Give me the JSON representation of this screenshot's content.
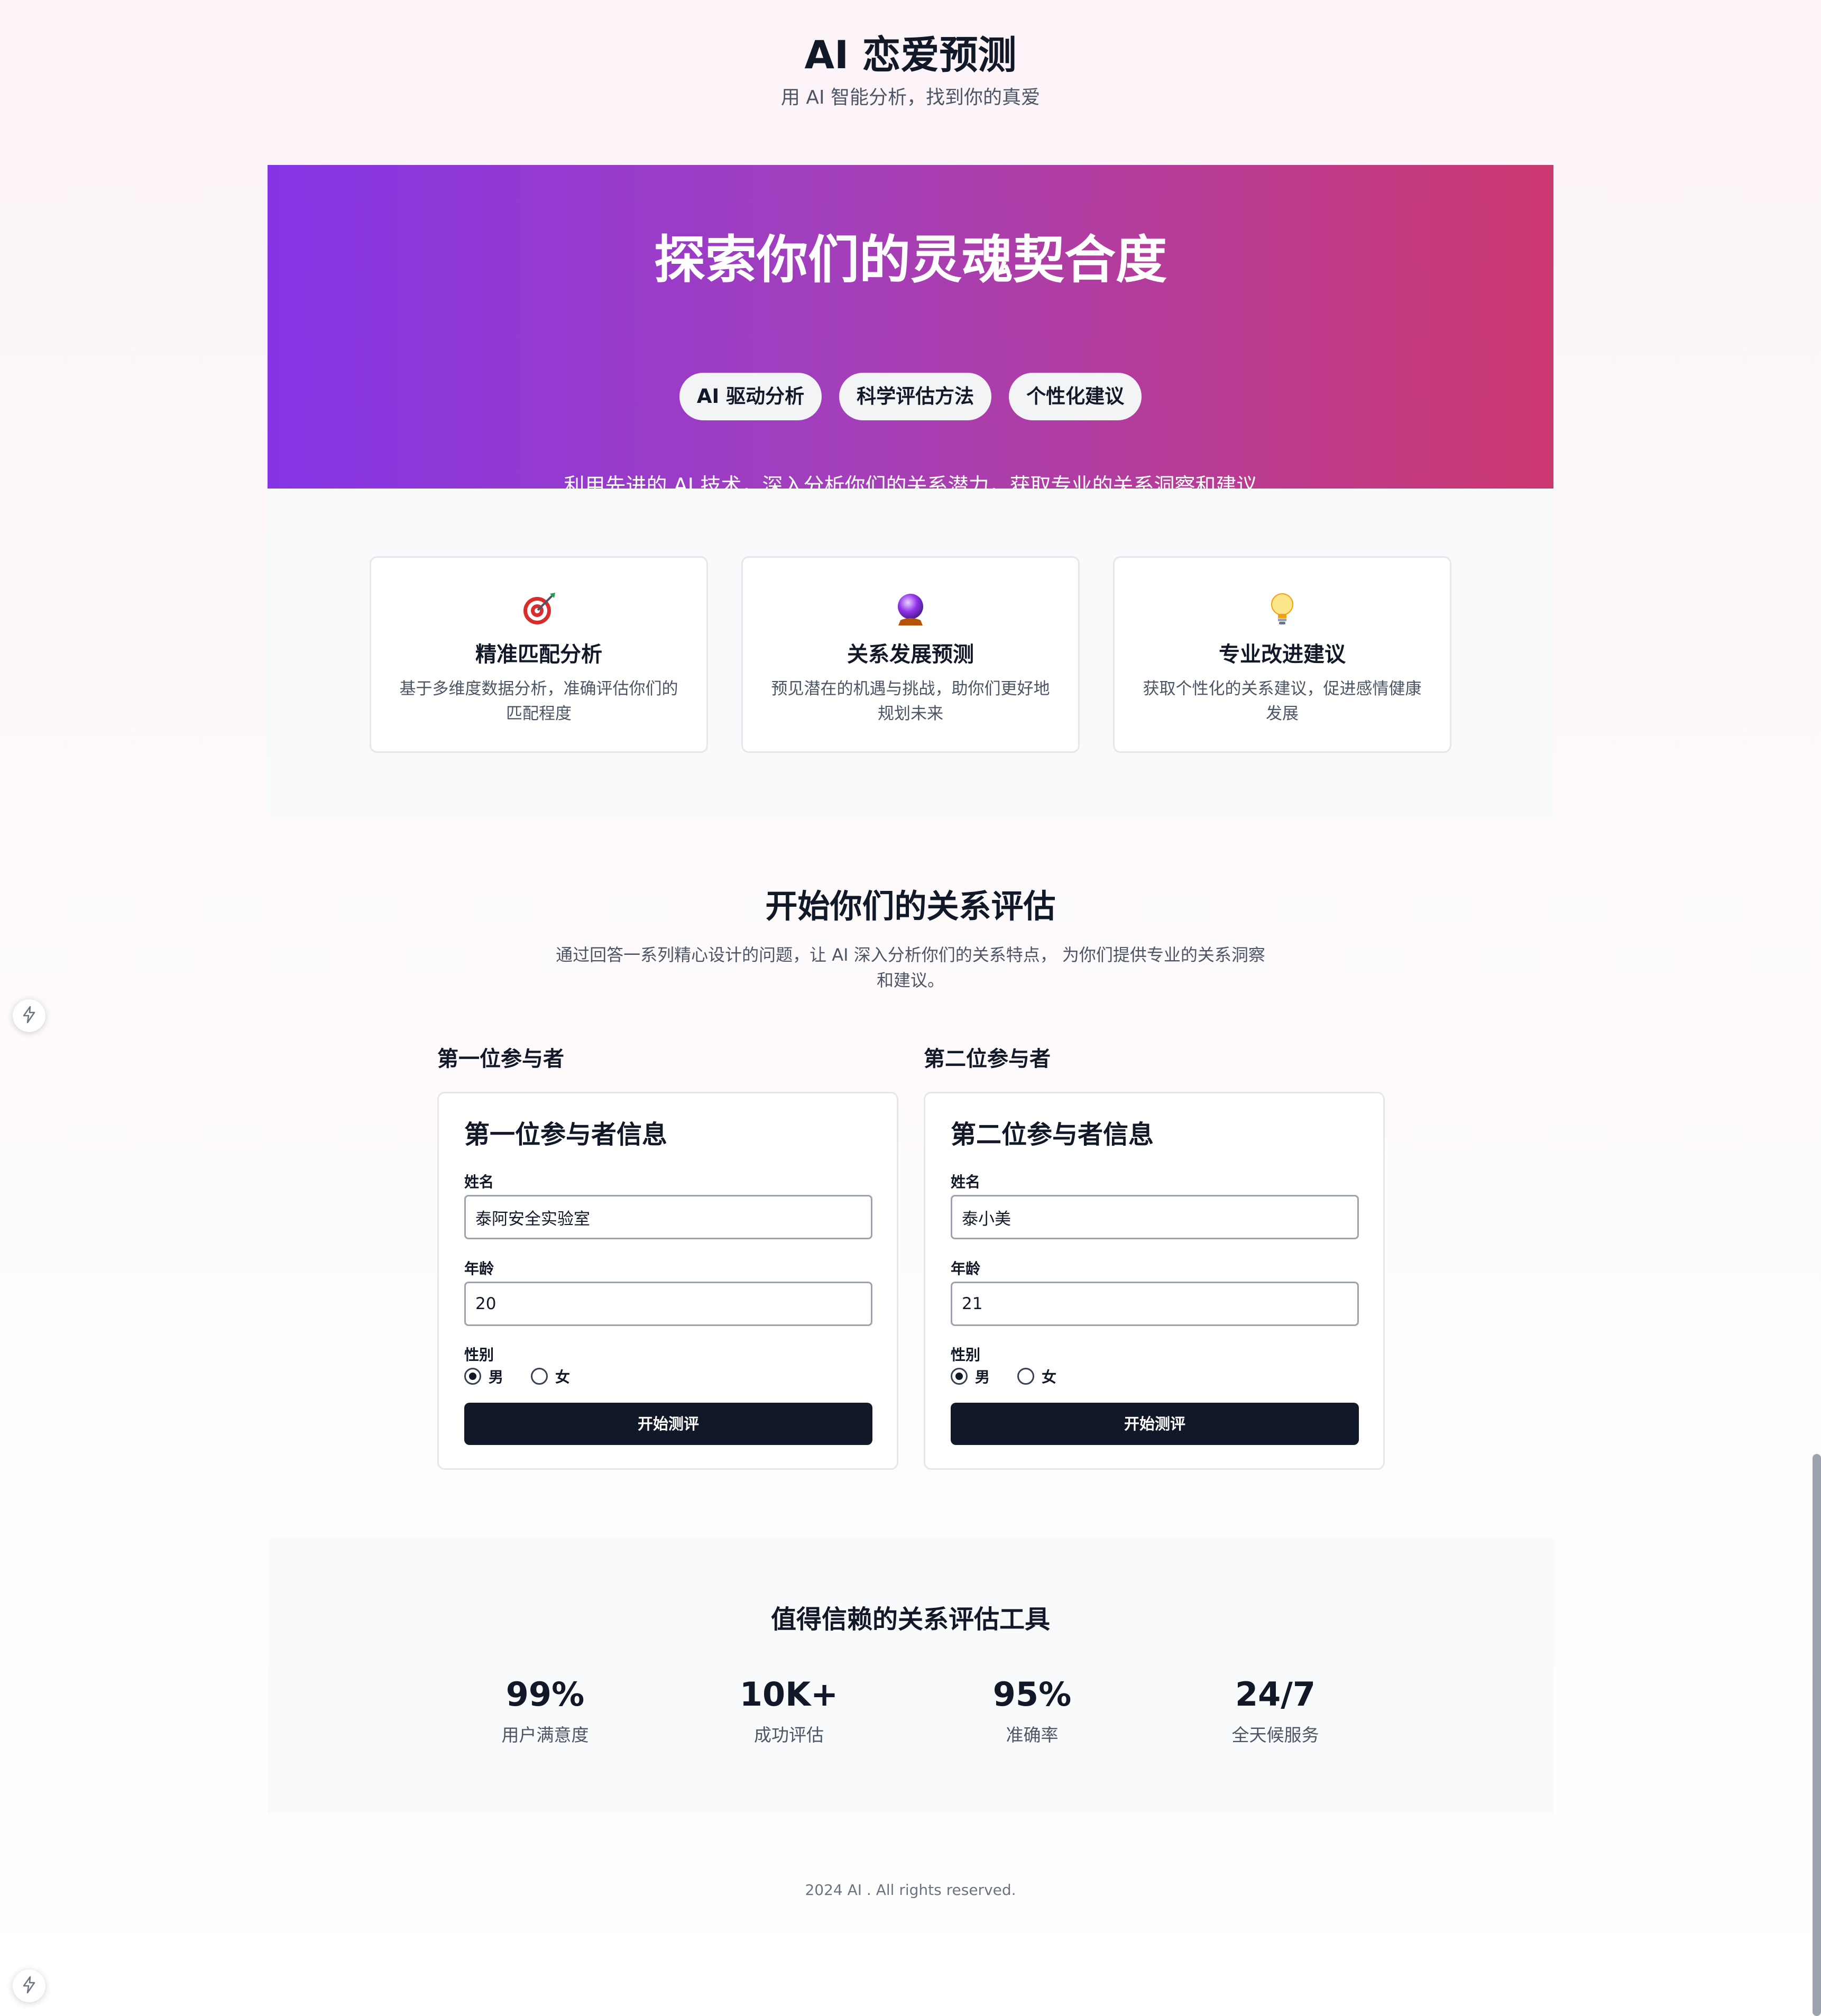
{
  "header": {
    "title": "AI 恋爱预测",
    "subtitle": "用 AI 智能分析，找到你的真爱"
  },
  "hero": {
    "title": "探索你们的灵魂契合度",
    "description": "利用先进的 AI 技术，深入分析你们的关系潜力，获取专业的关系洞察和建议",
    "tags": [
      "AI 驱动分析",
      "科学评估方法",
      "个性化建议"
    ],
    "gradient": [
      "#8635e6",
      "#cc3870"
    ]
  },
  "features": [
    {
      "icon": "target-icon",
      "title": "精准匹配分析",
      "desc": "基于多维度数据分析，准确评估你们的匹配程度"
    },
    {
      "icon": "crystal-ball-icon",
      "title": "关系发展预测",
      "desc": "预见潜在的机遇与挑战，助你们更好地规划未来"
    },
    {
      "icon": "lightbulb-icon",
      "title": "专业改进建议",
      "desc": "获取个性化的关系建议，促进感情健康发展"
    }
  ],
  "evaluation": {
    "title": "开始你们的关系评估",
    "description": "通过回答一系列精心设计的问题，让 AI 深入分析你们的关系特点， 为你们提供专业的关系洞察和建议。"
  },
  "participants": [
    {
      "section_label": "第一位参与者",
      "form_title": "第一位参与者信息",
      "name_label": "姓名",
      "name_value": "泰阿安全实验室",
      "age_label": "年龄",
      "age_value": "20",
      "gender_label": "性别",
      "gender_options": [
        "男",
        "女"
      ],
      "gender_selected": "男",
      "submit_label": "开始测评"
    },
    {
      "section_label": "第二位参与者",
      "form_title": "第二位参与者信息",
      "name_label": "姓名",
      "name_value": "泰小美",
      "age_label": "年龄",
      "age_value": "21",
      "gender_label": "性别",
      "gender_options": [
        "男",
        "女"
      ],
      "gender_selected": "男",
      "submit_label": "开始测评"
    }
  ],
  "stats": {
    "title": "值得信赖的关系评估工具",
    "items": [
      {
        "value": "99%",
        "label": "用户满意度"
      },
      {
        "value": "10K+",
        "label": "成功评估"
      },
      {
        "value": "95%",
        "label": "准确率"
      },
      {
        "value": "24/7",
        "label": "全天候服务"
      }
    ]
  },
  "footer": {
    "text": "2024 AI . All rights reserved."
  },
  "colors": {
    "primary": "#111827",
    "muted": "#4b5563",
    "section_bg": "#f9fafb"
  }
}
